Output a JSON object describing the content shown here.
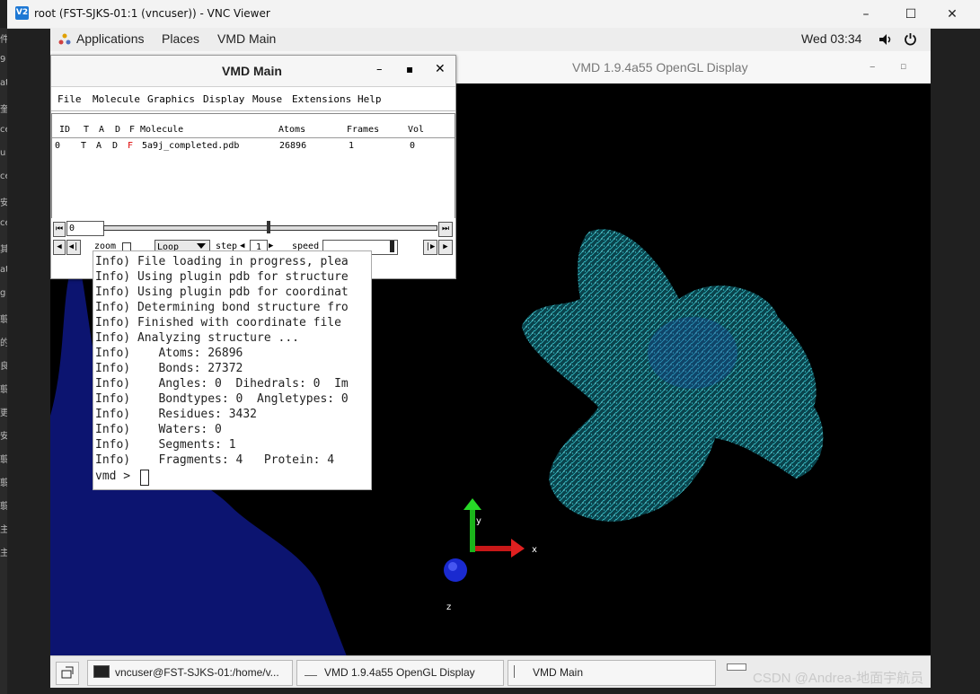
{
  "vnc": {
    "title": "root (FST-SJKS-01:1 (vncuser)) - VNC Viewer",
    "logo": "V2",
    "controls": [
      "–",
      "☐",
      "✕"
    ]
  },
  "host_strip": [
    "件",
    "9",
    "at",
    "奎",
    "ce",
    "u",
    "ce",
    "安",
    "ce",
    "其",
    "at",
    "g",
    "翦",
    "的",
    "良",
    "翦",
    "更",
    "安",
    "翦",
    "翦",
    "翦",
    "主",
    "主"
  ],
  "gnome": {
    "applications": "Applications",
    "places": "Places",
    "vmd_main": "VMD Main",
    "clock": "Wed 03:34",
    "volume_icon": "volume-icon",
    "power_icon": "power-icon"
  },
  "gl_window": {
    "title": "VMD 1.9.4a55 OpenGL Display",
    "axes": {
      "x": "x",
      "y": "y",
      "z": "z"
    }
  },
  "vmd_main": {
    "title": "VMD Main",
    "menu": [
      "File",
      "Molecule",
      "Graphics",
      "Display",
      "Mouse",
      "Extensions",
      "Help"
    ],
    "columns": [
      "ID",
      "T",
      "A",
      "D",
      "F",
      "Molecule",
      "Atoms",
      "Frames",
      "Vol"
    ],
    "rows": [
      {
        "id": "0",
        "t": "T",
        "a": "A",
        "d": "D",
        "f": "F",
        "molecule": "5a9j_completed.pdb",
        "atoms": "26896",
        "frames": "1",
        "vol": "0"
      }
    ],
    "frame_value": "0",
    "zoom_label": "zoom",
    "loop_value": "Loop",
    "step_label": "step",
    "step_value": "1",
    "speed_label": "speed"
  },
  "console": {
    "lines": [
      "Info) File loading in progress, plea",
      "Info) Using plugin pdb for structure",
      "Info) Using plugin pdb for coordinat",
      "Info) Determining bond structure fro",
      "Info) Finished with coordinate file",
      "Info) Analyzing structure ...",
      "Info)    Atoms: 26896",
      "Info)    Bonds: 27372",
      "Info)    Angles: 0  Dihedrals: 0  Im",
      "Info)    Bondtypes: 0  Angletypes: 0",
      "Info)    Residues: 3432",
      "Info)    Waters: 0",
      "Info)    Segments: 1",
      "Info)    Fragments: 4   Protein: 4"
    ],
    "prompt": "vmd > "
  },
  "taskbar": {
    "terminal": "vncuser@FST-SJKS-01:/home/v...",
    "gl": "VMD 1.9.4a55 OpenGL Display",
    "main": "VMD Main"
  },
  "watermark": "CSDN @Andrea-地面宇航员"
}
